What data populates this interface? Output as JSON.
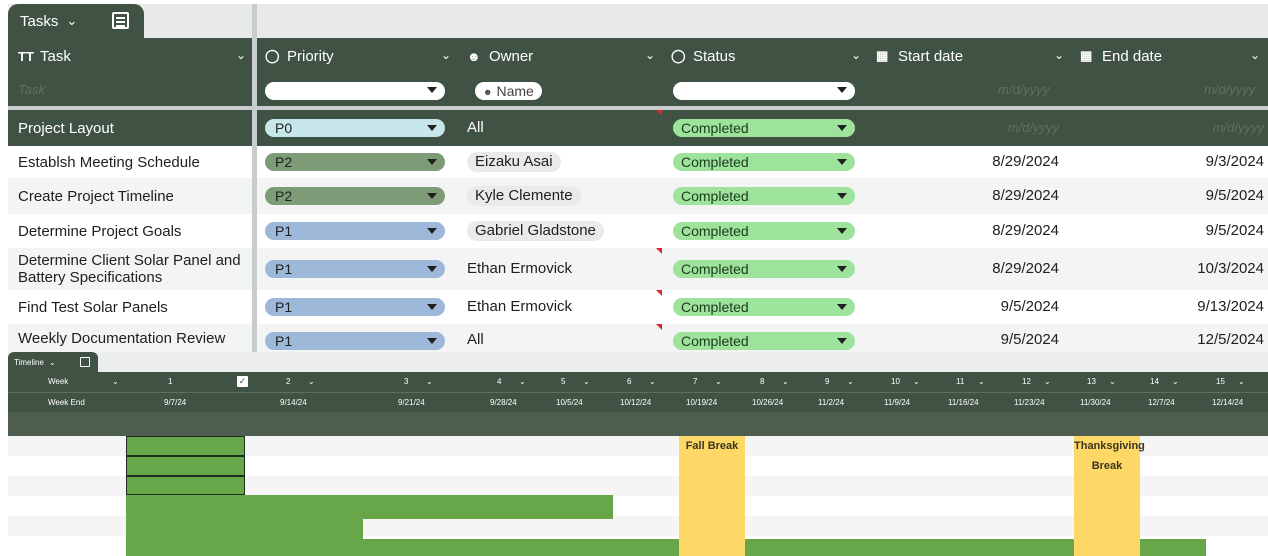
{
  "sheet_tab": {
    "label": "Tasks"
  },
  "columns": {
    "task": {
      "icon": "TT",
      "label": "Task"
    },
    "priority": {
      "label": "Priority"
    },
    "owner": {
      "label": "Owner"
    },
    "status": {
      "label": "Status"
    },
    "start": {
      "label": "Start date"
    },
    "end": {
      "label": "End date"
    }
  },
  "filters": {
    "task_placeholder": "Task",
    "owner_chip": "Name",
    "date_placeholder": "m/d/yyyy"
  },
  "group_row": {
    "task": "Project Layout",
    "priority": "P0",
    "owner": "All",
    "status": "Completed",
    "start": "m/d/yyyy",
    "end": "m/d/yyyy"
  },
  "rows": [
    {
      "task": "Establsh Meeting Schedule",
      "priority": "P2",
      "owner": "Eizaku Asai",
      "status": "Completed",
      "start": "8/29/2024",
      "end": "9/3/2024"
    },
    {
      "task": "Create Project Timeline",
      "priority": "P2",
      "owner": "Kyle Clemente",
      "status": "Completed",
      "start": "8/29/2024",
      "end": "9/5/2024"
    },
    {
      "task": "Determine Project Goals",
      "priority": "P1",
      "owner": "Gabriel Gladstone",
      "status": "Completed",
      "start": "8/29/2024",
      "end": "9/5/2024"
    },
    {
      "task": "Determine Client Solar Panel and Battery Specifications",
      "priority": "P1",
      "owner": "Ethan Ermovick",
      "status": "Completed",
      "start": "8/29/2024",
      "end": "10/3/2024"
    },
    {
      "task": "Find Test Solar Panels",
      "priority": "P1",
      "owner": "Ethan Ermovick",
      "status": "Completed",
      "start": "9/5/2024",
      "end": "9/13/2024"
    },
    {
      "task": "Weekly Documentation Review",
      "priority": "P1",
      "owner": "All",
      "status": "Completed",
      "start": "9/5/2024",
      "end": "12/5/2024"
    }
  ],
  "priority_colors": {
    "P0": "#c7e6ea",
    "P1": "#9db8d8",
    "P2": "#7d9b76"
  },
  "timeline": {
    "tab_label": "Timeline",
    "week_label": "Week",
    "week_end_label": "Week End",
    "weeks": [
      "1",
      "2",
      "3",
      "4",
      "5",
      "6",
      "7",
      "8",
      "9",
      "10",
      "11",
      "12",
      "13",
      "14",
      "15"
    ],
    "week_ends": [
      "9/7/24",
      "9/14/24",
      "9/21/24",
      "9/28/24",
      "10/5/24",
      "10/12/24",
      "10/19/24",
      "10/26/24",
      "11/2/24",
      "11/9/24",
      "11/16/24",
      "11/23/24",
      "11/30/24",
      "12/7/24",
      "12/14/24"
    ],
    "fall_break": "Fall Break",
    "thanksgiving_line1": "Thanksgiving",
    "thanksgiving_line2": "Break",
    "bar_color": "#67a74a",
    "break_color": "#fdd866"
  }
}
